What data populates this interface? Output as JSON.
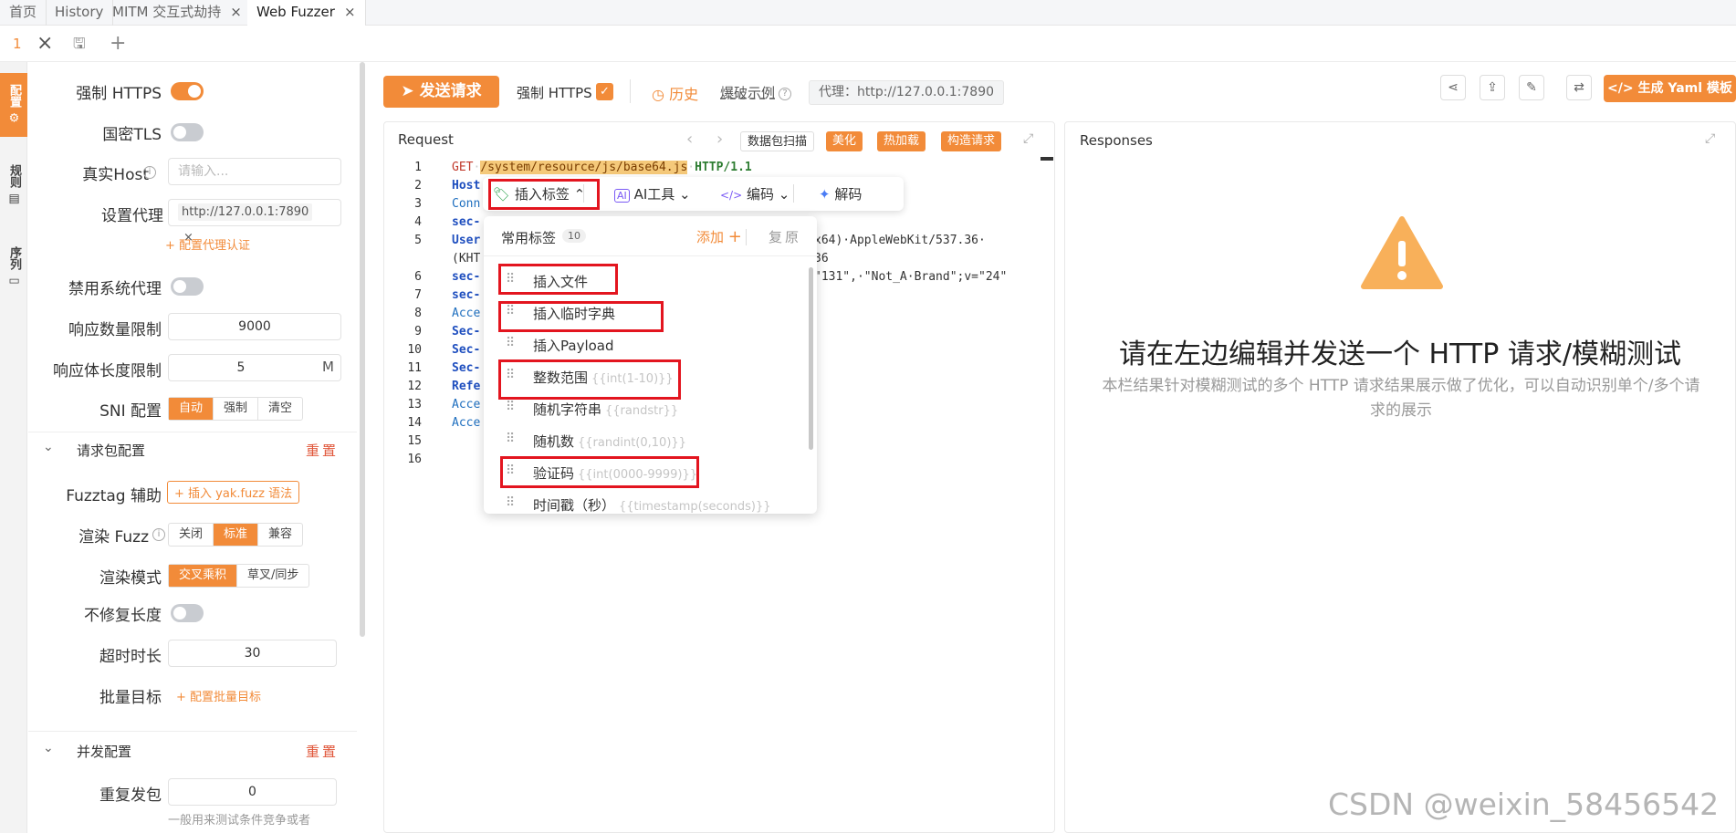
{
  "tabs": {
    "home": "首页",
    "history": "History",
    "mitm": "MITM 交互式劫持",
    "webfuzzer": "Web Fuzzer",
    "close": "×"
  },
  "subbar": {
    "index": "1",
    "close": "×",
    "save": "🖫",
    "add": "+"
  },
  "side_tabs": {
    "config": "配置",
    "rules": "规则",
    "sequence": "序列"
  },
  "config": {
    "force_https": "强制 HTTPS",
    "gm_tls": "国密TLS",
    "real_host": "真实Host",
    "real_host_placeholder": "请输入...",
    "proxy": "设置代理",
    "proxy_value": "http://127.0.0.1:7890",
    "proxy_auth_link": "+ 配置代理认证",
    "disable_sys_proxy": "禁用系统代理",
    "resp_count_limit": "响应数量限制",
    "resp_count_value": "9000",
    "resp_body_limit": "响应体长度限制",
    "resp_body_value": "5",
    "resp_body_unit": "M",
    "sni": "SNI 配置",
    "sni_options": [
      "自动",
      "强制",
      "清空"
    ],
    "req_section": "请求包配置",
    "reset": "重置",
    "fuzztag_helper": "Fuzztag 辅助",
    "fuzztag_btn": "+ 插入 yak.fuzz 语法",
    "render_fuzz": "渲染 Fuzz",
    "render_fuzz_options": [
      "关闭",
      "标准",
      "兼容"
    ],
    "render_mode": "渲染模式",
    "render_mode_options": [
      "交叉乘积",
      "草叉/同步"
    ],
    "no_fix_length": "不修复长度",
    "timeout": "超时时长",
    "timeout_value": "30",
    "batch_target": "批量目标",
    "batch_target_link": "+ 配置批量目标",
    "concurrency_section": "并发配置",
    "repeat_send": "重复发包",
    "repeat_value": "0",
    "repeat_hint": "一般用来测试条件竞争或者"
  },
  "toolbar": {
    "send": "发送请求",
    "force_https": "强制 HTTPS",
    "history": "历史",
    "example": "爆破示例",
    "proxy_label": "代理：http://127.0.0.1:7890",
    "gen_yaml": "生成 Yaml 模板"
  },
  "request": {
    "title": "Request",
    "packet_scan": "数据包扫描",
    "beautify": "美化",
    "hot_load": "热加载",
    "build": "构造请求",
    "line_numbers": [
      "1",
      "2",
      "3",
      "4",
      "5",
      "",
      "6",
      "7",
      "8",
      "9",
      "10",
      "11",
      "12",
      "13",
      "14",
      "15",
      "16"
    ],
    "code": {
      "l1_method": "GET",
      "l1_path": "/system/resource/js/base64.js",
      "l1_proto": "HTTP/1.1",
      "l2": "Host",
      "l3": "Conn",
      "l4": "sec-",
      "l5": "User",
      "l5_rest": "x64)·AppleWebKit/537.36·",
      "l5b": "(KHT",
      "l5b_rest": "36",
      "l6": "sec-",
      "l6_rest": "\"131\",·\"Not_A·Brand\";v=\"24\"",
      "l7": "sec-",
      "l8": "Acce",
      "l9": "Sec-",
      "l10": "Sec-",
      "l11": "Sec-",
      "l12": "Refe",
      "l13": "Acce",
      "l14": "Acce"
    }
  },
  "editor_tools": {
    "insert_tag": "插入标签",
    "ai_tool": "AI工具",
    "encode": "编码",
    "decode": "解码"
  },
  "tag_popup": {
    "title": "常用标签",
    "count": "10",
    "add": "添加",
    "restore": "复原",
    "items": [
      {
        "name": "插入文件",
        "hint": ""
      },
      {
        "name": "插入临时字典",
        "hint": ""
      },
      {
        "name": "插入Payload",
        "hint": ""
      },
      {
        "name": "整数范围",
        "hint": "{{int(1-10)}}"
      },
      {
        "name": "随机字符串",
        "hint": "{{randstr}}"
      },
      {
        "name": "随机数",
        "hint": "{{randint(0,10)}}"
      },
      {
        "name": "验证码",
        "hint": "{{int(0000-9999)}}"
      },
      {
        "name": "时间戳（秒）",
        "hint": "{{timestamp(seconds)}}"
      }
    ]
  },
  "responses": {
    "title": "Responses",
    "empty_title": "请在左边编辑并发送一个 HTTP 请求/模糊测试",
    "empty_desc": "本栏结果针对模糊测试的多个 HTTP 请求结果展示做了优化，可以自动识别单个/多个请求的展示"
  },
  "watermark": "CSDN @weixin_58456542",
  "colors": {
    "accent": "#f28b39",
    "highlight": "#e3151f"
  }
}
